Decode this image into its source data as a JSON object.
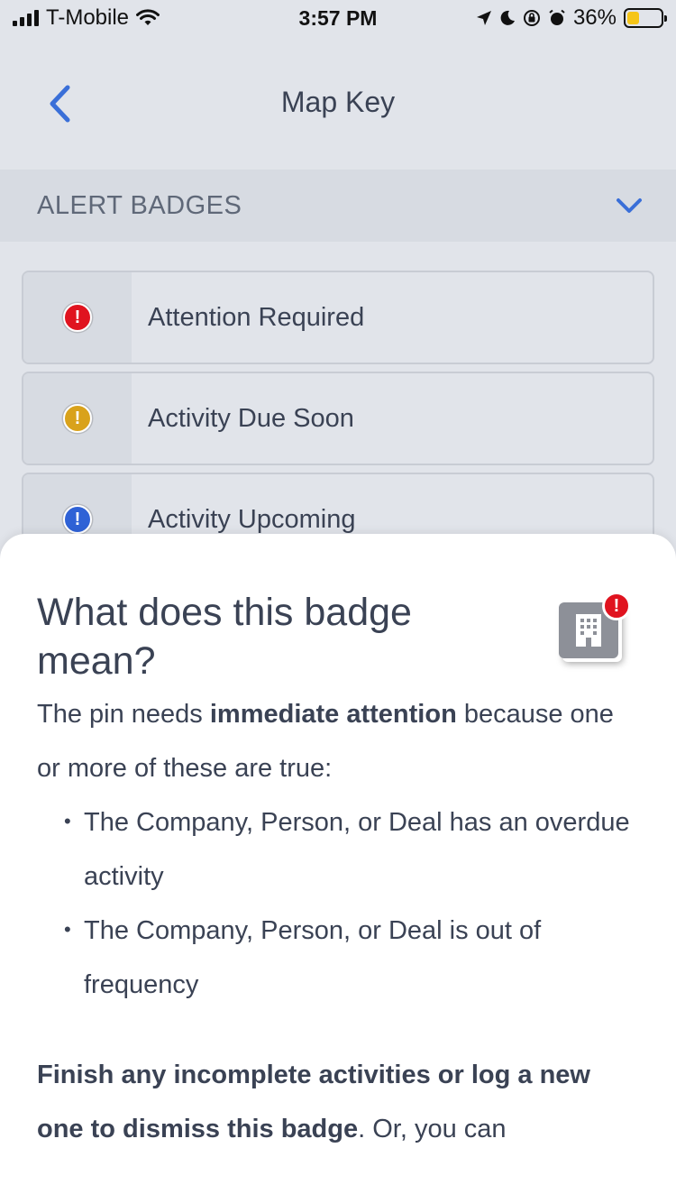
{
  "status_bar": {
    "carrier": "T-Mobile",
    "time": "3:57 PM",
    "battery_percent": "36%",
    "battery_level": 0.36,
    "icons": [
      "signal-icon",
      "wifi-icon",
      "location-icon",
      "moon-icon",
      "rotation-lock-icon",
      "alarm-icon",
      "battery-icon"
    ]
  },
  "header": {
    "title": "Map Key",
    "back_icon": "chevron-left-icon"
  },
  "section": {
    "title": "ALERT BADGES",
    "toggle_icon": "chevron-down-icon"
  },
  "badges": [
    {
      "label": "Attention Required",
      "color": "#e0131f",
      "icon": "exclamation-icon"
    },
    {
      "label": "Activity Due Soon",
      "color": "#d9a21b",
      "icon": "exclamation-icon"
    },
    {
      "label": "Activity Upcoming",
      "color": "#2f62d6",
      "icon": "exclamation-icon"
    }
  ],
  "sheet": {
    "title": "What does this badge mean?",
    "intro_before": "The pin needs ",
    "intro_bold": "immediate attention",
    "intro_after": " because one or more of these are true:",
    "bullets": [
      "The Company, Person, or Deal has an overdue activity",
      "The Company, Person, or Deal is out of frequency"
    ],
    "note_bold": "Finish any incomplete activities or log a new one to dismiss this badge",
    "note_after": ". Or, you can",
    "illustration_icon": "building-pin-icon",
    "illustration_badge": "!"
  },
  "colors": {
    "accent": "#3a6fd8",
    "background": "#e1e4ea",
    "section_background": "#d7dbe2",
    "text": "#3a4254"
  }
}
